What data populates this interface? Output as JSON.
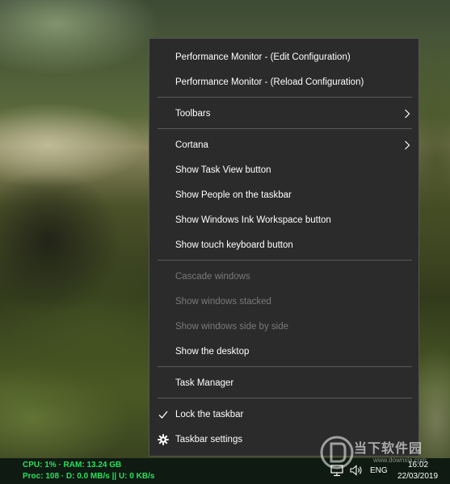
{
  "menu": {
    "items": [
      {
        "label": "Performance Monitor - (Edit Configuration)"
      },
      {
        "label": "Performance Monitor - (Reload Configuration)"
      },
      {
        "label": "Toolbars"
      },
      {
        "label": "Cortana"
      },
      {
        "label": "Show Task View button"
      },
      {
        "label": "Show People on the taskbar"
      },
      {
        "label": "Show Windows Ink Workspace button"
      },
      {
        "label": "Show touch keyboard button"
      },
      {
        "label": "Cascade windows"
      },
      {
        "label": "Show windows stacked"
      },
      {
        "label": "Show windows side by side"
      },
      {
        "label": "Show the desktop"
      },
      {
        "label": "Task Manager"
      },
      {
        "label": "Lock the taskbar"
      },
      {
        "label": "Taskbar settings"
      }
    ]
  },
  "taskbar": {
    "perf_line1": "CPU: 1% · RAM: 13.24 GB",
    "perf_line2": "Proc: 108 · D: 0.0 MB/s || U: 0 KB/s",
    "language": "ENG",
    "time": "16:02",
    "date": "22/03/2019"
  },
  "watermark": {
    "brand": "当下软件园",
    "url": "www.downxia.com"
  },
  "colors": {
    "menu_bg": "#2b2b2b",
    "menu_text": "#ffffff",
    "menu_disabled_text": "#7a7a7a",
    "separator": "#5a5a5a",
    "perf_text": "#28e05a",
    "taskbar_bg": "#0e1a12"
  },
  "icons": {
    "submenu": "chevron-right-icon",
    "checked": "check-icon",
    "settings": "gear-icon",
    "network": "network-icon",
    "volume": "speaker-icon"
  }
}
